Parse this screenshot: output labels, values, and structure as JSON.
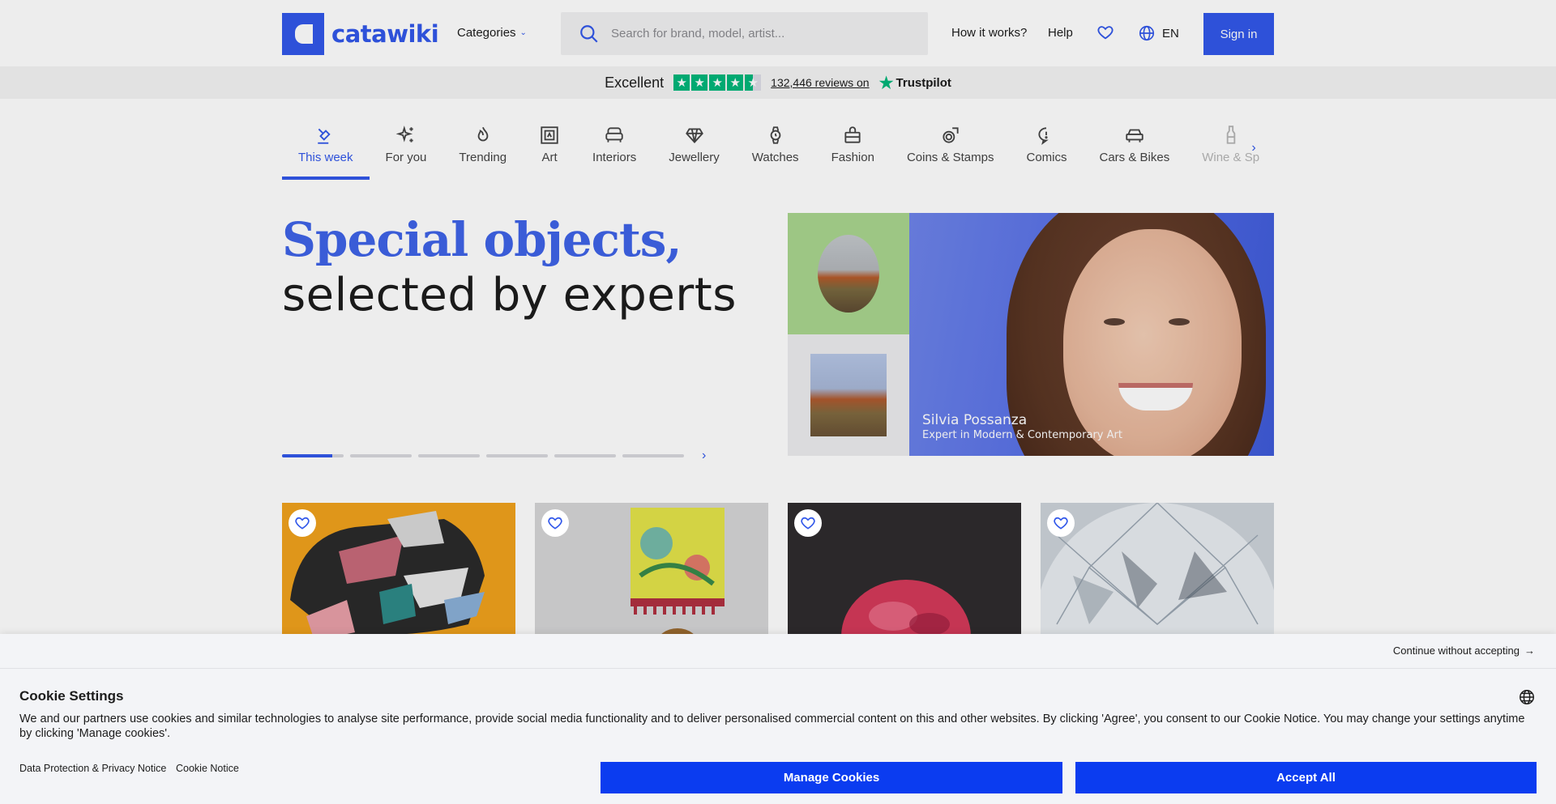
{
  "brand": {
    "name": "catawiki"
  },
  "header": {
    "categories_label": "Categories",
    "search_placeholder": "Search for brand, model, artist...",
    "how_it_works": "How it works?",
    "help": "Help",
    "language": "EN",
    "sign_in": "Sign in"
  },
  "trustpilot": {
    "rating_label": "Excellent",
    "reviews": "132,446 reviews on",
    "provider": "Trustpilot",
    "stars": 4.5
  },
  "category_nav": {
    "items": [
      {
        "label": "This week",
        "icon": "gavel-icon",
        "active": true
      },
      {
        "label": "For you",
        "icon": "sparkles-icon"
      },
      {
        "label": "Trending",
        "icon": "flame-icon"
      },
      {
        "label": "Art",
        "icon": "frame-icon"
      },
      {
        "label": "Interiors",
        "icon": "sofa-icon"
      },
      {
        "label": "Jewellery",
        "icon": "diamond-icon"
      },
      {
        "label": "Watches",
        "icon": "watch-icon"
      },
      {
        "label": "Fashion",
        "icon": "bag-icon"
      },
      {
        "label": "Coins & Stamps",
        "icon": "coins-icon"
      },
      {
        "label": "Comics",
        "icon": "speech-bubble-icon"
      },
      {
        "label": "Cars & Bikes",
        "icon": "car-icon"
      },
      {
        "label": "Wine & Sp",
        "icon": "bottle-icon"
      }
    ]
  },
  "hero": {
    "title_line1": "Special objects,",
    "title_line2": "selected by experts",
    "slides_count": 6,
    "active_slide": 1,
    "expert_name": "Silvia Possanza",
    "expert_role": "Expert in Modern & Contemporary Art"
  },
  "cards": [
    {
      "image": "abstract-collage"
    },
    {
      "image": "lampshade"
    },
    {
      "image": "red-mineral"
    },
    {
      "image": "diamond"
    }
  ],
  "cookie_banner": {
    "continue_label": "Continue without accepting",
    "title": "Cookie Settings",
    "text": "We and our partners use cookies and similar technologies to analyse site performance, provide social media functionality and to deliver personalised commercial content on this and other websites. By clicking 'Agree', you consent to our Cookie Notice. You may change your settings anytime by clicking 'Manage cookies'.",
    "privacy_link": "Data Protection & Privacy Notice",
    "cookie_notice_link": "Cookie Notice",
    "manage_button": "Manage Cookies",
    "accept_button": "Accept All"
  },
  "colors": {
    "brand": "#3258ea",
    "button": "#0b3cf0",
    "trustpilot": "#00b67a"
  }
}
